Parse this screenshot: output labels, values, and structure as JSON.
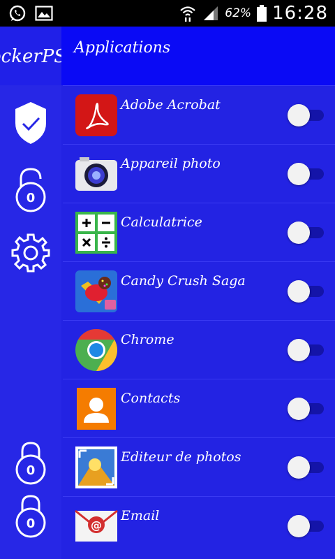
{
  "status_bar": {
    "battery_percent": "62%",
    "time": "16:28",
    "icons": [
      "whatsapp-icon",
      "gallery-icon",
      "wifi-icon",
      "signal-icon",
      "battery-icon"
    ]
  },
  "header": {
    "app_name": "ockerPS",
    "title": "Applications"
  },
  "sidebar": {
    "items": [
      {
        "name": "shield-check-icon"
      },
      {
        "name": "unlocked-padlock-icon",
        "count": "0"
      },
      {
        "name": "settings-gear-icon"
      },
      {
        "name": "padlock-icon",
        "count": "0"
      },
      {
        "name": "padlock-icon",
        "count": "0"
      }
    ]
  },
  "apps": [
    {
      "label": "Adobe Acrobat",
      "icon": "adobe-acrobat-icon",
      "locked": false
    },
    {
      "label": "Appareil photo",
      "icon": "camera-icon",
      "locked": false
    },
    {
      "label": "Calculatrice",
      "icon": "calculator-icon",
      "locked": false
    },
    {
      "label": "Candy Crush Saga",
      "icon": "candy-crush-icon",
      "locked": false
    },
    {
      "label": "Chrome",
      "icon": "chrome-icon",
      "locked": false
    },
    {
      "label": "Contacts",
      "icon": "contacts-icon",
      "locked": false
    },
    {
      "label": "Editeur de photos",
      "icon": "photo-editor-icon",
      "locked": false
    },
    {
      "label": "Email",
      "icon": "email-icon",
      "locked": false
    }
  ],
  "colors": {
    "background": "#2323e3",
    "header": "#0a0af5",
    "toggle_track": "#1414a8",
    "toggle_knob": "#f2f2f2"
  }
}
